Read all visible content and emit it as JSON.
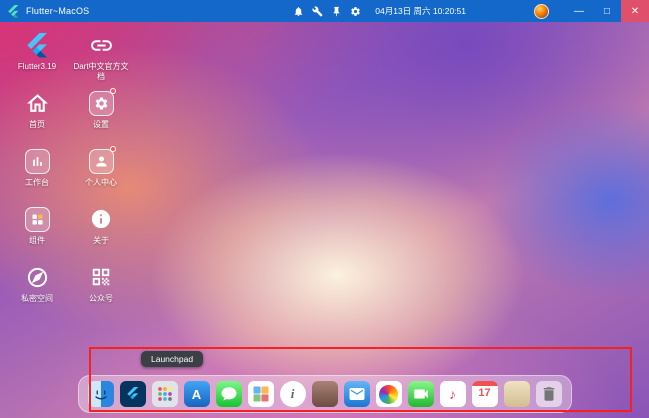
{
  "window": {
    "title": "Flutter~MacOS",
    "controls": {
      "minimize": "—",
      "maximize": "□",
      "close": "✕"
    },
    "statusbar": {
      "datetime": "04月13日 周六 10:20:51"
    }
  },
  "desktop": {
    "icons": [
      {
        "label": "Flutter3.19",
        "icon": "flutter-logo"
      },
      {
        "label": "Dart中文官方文档",
        "icon": "link"
      },
      {
        "label": "首页",
        "icon": "home"
      },
      {
        "label": "设置",
        "icon": "gear-tile"
      },
      {
        "label": "工作台",
        "icon": "bar-chart-tile"
      },
      {
        "label": "个人中心",
        "icon": "person-tile"
      },
      {
        "label": "组件",
        "icon": "widgets-tile"
      },
      {
        "label": "关于",
        "icon": "info-circle"
      },
      {
        "label": "私密空间",
        "icon": "compass"
      },
      {
        "label": "公众号",
        "icon": "qr-code"
      }
    ]
  },
  "dock": {
    "tooltip": "Launchpad",
    "items": [
      {
        "name": "finder"
      },
      {
        "name": "flutter"
      },
      {
        "name": "launchpad"
      },
      {
        "name": "app-store",
        "glyph": "A"
      },
      {
        "name": "messages"
      },
      {
        "name": "screens-grid"
      },
      {
        "name": "info",
        "glyph": "i"
      },
      {
        "name": "contacts"
      },
      {
        "name": "mail"
      },
      {
        "name": "photos"
      },
      {
        "name": "facetime"
      },
      {
        "name": "music",
        "glyph": "♪"
      },
      {
        "name": "calendar",
        "glyph": "17"
      },
      {
        "name": "notes"
      },
      {
        "name": "trash"
      }
    ]
  },
  "annotation": {
    "highlight_color": "#f62121"
  },
  "colors": {
    "titlebar": "#1368c9"
  }
}
